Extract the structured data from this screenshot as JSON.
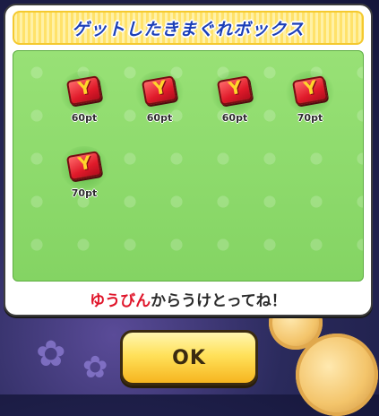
{
  "dialog": {
    "title": "ゲットしたきまぐれボックス",
    "message_prefix": "ゆうびん",
    "message_suffix": "からうけとってね！",
    "ok_label": "OK"
  },
  "rewards": [
    {
      "name": "Y-card",
      "icon": "y-card-icon",
      "label": "60pt"
    },
    {
      "name": "Y-card",
      "icon": "y-card-icon",
      "label": "60pt"
    },
    {
      "name": "Y-card",
      "icon": "y-card-icon",
      "label": "60pt"
    },
    {
      "name": "Y-card",
      "icon": "y-card-icon",
      "label": "70pt"
    },
    {
      "name": "Y-card",
      "icon": "y-card-icon",
      "label": "70pt"
    }
  ],
  "colors": {
    "title_text": "#1b3fb8",
    "banner": "#ffe26a",
    "content_bg": "#8fda6c",
    "message_highlight": "#e0152a",
    "ok_button": "#ffe15a"
  }
}
